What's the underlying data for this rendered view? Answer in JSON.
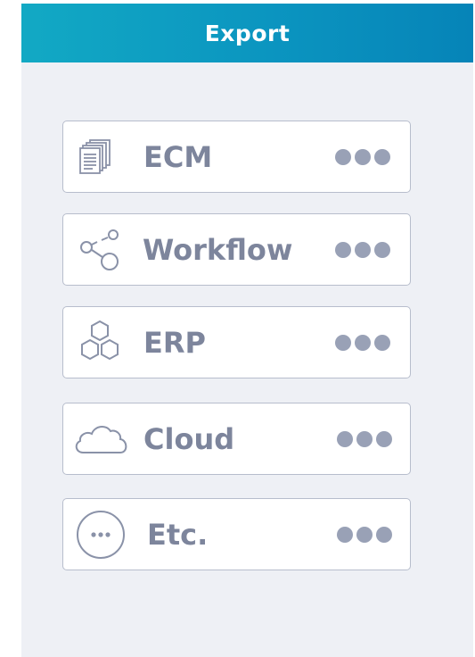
{
  "header": {
    "title": "Export"
  },
  "items": [
    {
      "id": "ecm",
      "label": "ECM",
      "icon": "documents-icon"
    },
    {
      "id": "workflow",
      "label": "Workflow",
      "icon": "workflow-icon"
    },
    {
      "id": "erp",
      "label": "ERP",
      "icon": "hexagons-icon"
    },
    {
      "id": "cloud",
      "label": "Cloud",
      "icon": "cloud-icon"
    },
    {
      "id": "etc",
      "label": "Etc.",
      "icon": "ellipsis-circle-icon"
    }
  ],
  "colors": {
    "header_start": "#12a9c4",
    "header_end": "#0684b8",
    "text": "#7d859c",
    "dots": "#99a1b6",
    "border": "#b7bdcc"
  }
}
